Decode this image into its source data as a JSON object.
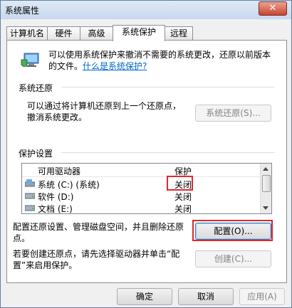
{
  "window": {
    "title": "系统属性",
    "close_label": "✕"
  },
  "tabs": [
    {
      "label": "计算机名"
    },
    {
      "label": "硬件"
    },
    {
      "label": "高级"
    },
    {
      "label": "系统保护"
    },
    {
      "label": "远程"
    }
  ],
  "intro": {
    "text": "可以使用系统保护来撤消不需要的系统更改，还原以前版本的文件。",
    "link": "什么是系统保护?"
  },
  "restore": {
    "group_label": "系统还原",
    "description": "可以通过将计算机还原到上一个还原点，撤消系统更改。",
    "button_label": "系统还原(S)..."
  },
  "protection": {
    "group_label": "保护设置",
    "columns": [
      "可用驱动器",
      "保护"
    ],
    "rows": [
      {
        "drive": "系统 (C:) (系统)",
        "status": "关闭"
      },
      {
        "drive": "软件 (D:)",
        "status": "关闭"
      },
      {
        "drive": "文档 (E:)",
        "status": "关闭"
      }
    ],
    "configure_text": "配置还原设置、管理磁盘空间，并且删除还原点。",
    "configure_button": "配置(O)...",
    "create_text": "若要创建还原点，请先选择驱动器并单击“配置”来启用保护。",
    "create_button": "创建(C)..."
  },
  "footer": {
    "ok": "确定",
    "cancel": "取消",
    "apply": "应用(A)"
  },
  "colors": {
    "highlight_box": "#e0282e",
    "link": "#0066cc"
  }
}
